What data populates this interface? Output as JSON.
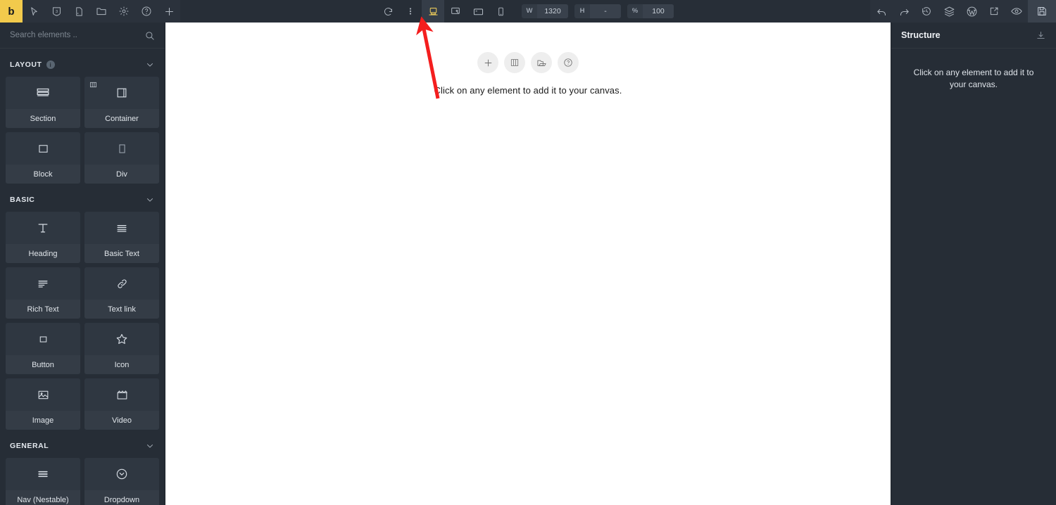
{
  "app": {
    "logo_letter": "b",
    "brand_color": "#f2ca4c"
  },
  "toolbar": {
    "left_icons": [
      {
        "name": "cursor-icon",
        "label": "Select"
      },
      {
        "name": "css-icon",
        "label": "CSS"
      },
      {
        "name": "page-icon",
        "label": "Page"
      },
      {
        "name": "folder-icon",
        "label": "Templates"
      },
      {
        "name": "gear-icon",
        "label": "Settings"
      },
      {
        "name": "help-icon",
        "label": "Help"
      },
      {
        "name": "plus-icon",
        "label": "Add"
      }
    ],
    "center_icons": [
      {
        "name": "revisions-icon",
        "label": "Refresh"
      },
      {
        "name": "more-vertical-icon",
        "label": "More"
      },
      {
        "name": "desktop-icon",
        "label": "Desktop",
        "active": true
      },
      {
        "name": "laptop-icon",
        "label": "Laptop"
      },
      {
        "name": "tablet-icon",
        "label": "Tablet"
      },
      {
        "name": "mobile-icon",
        "label": "Mobile"
      }
    ],
    "size_fields": [
      {
        "name": "width-field",
        "label": "W",
        "value": "1320"
      },
      {
        "name": "height-field",
        "label": "H",
        "value": "-"
      },
      {
        "name": "zoom-field",
        "label": "%",
        "value": "100"
      }
    ],
    "right_icons": [
      {
        "name": "undo-icon",
        "label": "Undo"
      },
      {
        "name": "redo-icon",
        "label": "Redo"
      },
      {
        "name": "history-icon",
        "label": "Revisions"
      },
      {
        "name": "layers-icon",
        "label": "Global classes"
      },
      {
        "name": "wordpress-icon",
        "label": "WordPress"
      },
      {
        "name": "external-link-icon",
        "label": "Preview in new tab"
      },
      {
        "name": "eye-icon",
        "label": "Preview"
      },
      {
        "name": "save-icon",
        "label": "Save"
      }
    ]
  },
  "search": {
    "placeholder": "Search elements ..",
    "value": ""
  },
  "element_groups": [
    {
      "title": "LAYOUT",
      "has_info": true,
      "elements": [
        {
          "label": "Section",
          "icon": "section-icon",
          "badge": null
        },
        {
          "label": "Container",
          "icon": "container-icon",
          "badge": "columns-badge"
        },
        {
          "label": "Block",
          "icon": "block-icon",
          "badge": null
        },
        {
          "label": "Div",
          "icon": "div-icon",
          "badge": null
        }
      ]
    },
    {
      "title": "BASIC",
      "has_info": false,
      "elements": [
        {
          "label": "Heading",
          "icon": "heading-icon",
          "badge": null
        },
        {
          "label": "Basic Text",
          "icon": "basic-text-icon",
          "badge": null
        },
        {
          "label": "Rich Text",
          "icon": "rich-text-icon",
          "badge": null
        },
        {
          "label": "Text link",
          "icon": "link-icon",
          "badge": null
        },
        {
          "label": "Button",
          "icon": "button-icon",
          "badge": null
        },
        {
          "label": "Icon",
          "icon": "star-icon",
          "badge": null
        },
        {
          "label": "Image",
          "icon": "image-icon",
          "badge": null
        },
        {
          "label": "Video",
          "icon": "video-icon",
          "badge": null
        }
      ]
    },
    {
      "title": "GENERAL",
      "has_info": false,
      "elements": [
        {
          "label": "Nav (Nestable)",
          "icon": "nav-icon",
          "badge": null
        },
        {
          "label": "Dropdown",
          "icon": "dropdown-icon",
          "badge": null
        }
      ]
    }
  ],
  "canvas": {
    "buttons": [
      {
        "name": "add-element-button",
        "icon": "plus-icon"
      },
      {
        "name": "add-layout-button",
        "icon": "columns-icon"
      },
      {
        "name": "add-template-button",
        "icon": "folder-icon"
      },
      {
        "name": "canvas-help-button",
        "icon": "question-icon"
      }
    ],
    "hint": "Click on any element to add it to your canvas."
  },
  "structure": {
    "title": "Structure",
    "download_icon": "download-icon",
    "empty_message": "Click on any element to add it to your canvas."
  },
  "annotation": {
    "arrow_color": "#f41e1e",
    "points_to": "desktop-breakpoint-icon"
  }
}
